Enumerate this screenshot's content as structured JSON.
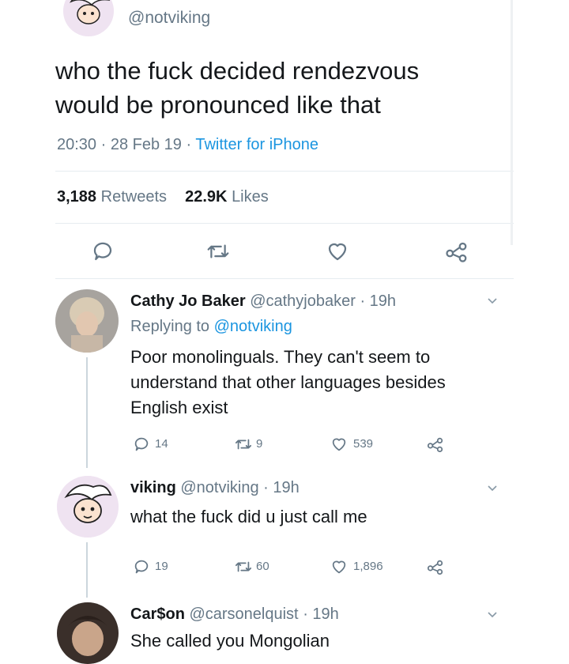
{
  "main_tweet": {
    "handle": "@notviking",
    "text_line1": "who the fuck decided rendezvous",
    "text_line2": "would be pronounced like that",
    "time": "20:30",
    "date": "28 Feb 19",
    "client": "Twitter for iPhone",
    "sep": "·",
    "retweets_count": "3,188",
    "retweets_label": "Retweets",
    "likes_count": "22.9K",
    "likes_label": "Likes"
  },
  "replies": [
    {
      "name": "Cathy Jo Baker",
      "handle": "@cathyjobaker",
      "time": "· 19h",
      "replying_prefix": "Replying to",
      "replying_to": "@notviking",
      "text_lines": [
        "Poor monolinguals. They can't seem to",
        "understand that other languages besides",
        "English exist"
      ],
      "replies": "14",
      "retweets": "9",
      "likes": "539"
    },
    {
      "name": "viking",
      "handle": "@notviking",
      "time": "· 19h",
      "text_lines": [
        "what the fuck did u just call me"
      ],
      "replies": "19",
      "retweets": "60",
      "likes": "1,896"
    },
    {
      "name": "Car$on",
      "handle": "@carsonelquist",
      "time": "· 19h",
      "text_lines": [
        "She called you Mongolian"
      ]
    }
  ],
  "colors": {
    "text": "#14171a",
    "secondary": "#657786",
    "link": "#1b95e0",
    "divider": "#e6ecf0"
  }
}
